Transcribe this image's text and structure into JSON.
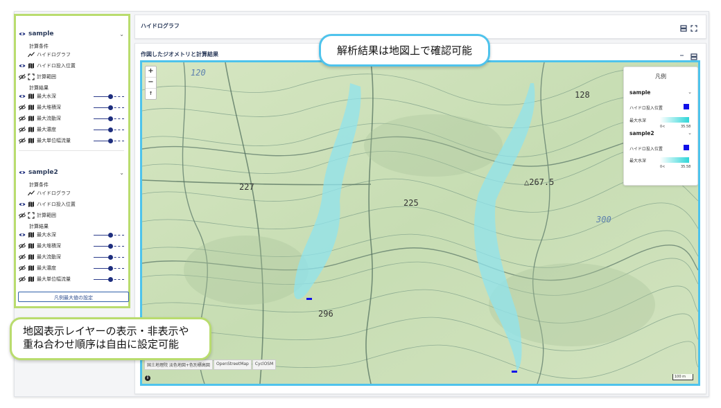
{
  "colors": {
    "accent_blue": "#4ec3ec",
    "accent_green": "#b9dc6e",
    "brand_navy": "#2a3a5a",
    "map_land": "#cfe1bb",
    "water_overlay": "#8fe3ee",
    "hydro_point": "#1010e8"
  },
  "sidebar": {
    "groups": [
      {
        "name": "sample",
        "conditions_label": "計算条件",
        "conditions": [
          {
            "label": "ハイドログラフ",
            "icon": "line-chart-icon"
          },
          {
            "label": "ハイドロ投入位置",
            "icon": "map-icon",
            "visible": true
          },
          {
            "label": "計算範囲",
            "icon": "extent-icon",
            "visible": false
          }
        ],
        "results_label": "計算結果",
        "results": [
          {
            "label": "最大水深",
            "visible": true,
            "opacity": 0.55
          },
          {
            "label": "最大堆積深",
            "visible": false,
            "opacity": 0.55
          },
          {
            "label": "最大流動深",
            "visible": false,
            "opacity": 0.55
          },
          {
            "label": "最大濃度",
            "visible": false,
            "opacity": 0.55
          },
          {
            "label": "最大単位幅流量",
            "visible": false,
            "opacity": 0.55
          }
        ]
      },
      {
        "name": "sample2",
        "conditions_label": "計算条件",
        "conditions": [
          {
            "label": "ハイドログラフ",
            "icon": "line-chart-icon"
          },
          {
            "label": "ハイドロ投入位置",
            "icon": "map-icon",
            "visible": true
          },
          {
            "label": "計算範囲",
            "icon": "extent-icon",
            "visible": false
          }
        ],
        "results_label": "計算結果",
        "results": [
          {
            "label": "最大水深",
            "visible": true,
            "opacity": 0.55
          },
          {
            "label": "最大堆積深",
            "visible": false,
            "opacity": 0.55
          },
          {
            "label": "最大流動深",
            "visible": false,
            "opacity": 0.55
          },
          {
            "label": "最大濃度",
            "visible": false,
            "opacity": 0.55
          },
          {
            "label": "最大単位幅流量",
            "visible": false,
            "opacity": 0.55
          }
        ]
      }
    ],
    "legend_button": "凡例最大値の設定"
  },
  "hydro_panel": {
    "title": "ハイドログラフ"
  },
  "map_panel": {
    "title": "作図したジオメトリと計算結果"
  },
  "map": {
    "zoom_in": "+",
    "zoom_out": "−",
    "north": "↑",
    "contour_labels": [
      "120",
      "128",
      "227",
      "225",
      "△267.5",
      "300",
      "296"
    ],
    "attribution": [
      "国土地理院 淡色地図+色別標高図",
      "OpenStreetMap",
      "CyclOSM"
    ],
    "info": "i",
    "scale": "100 m",
    "legend": {
      "title": "凡例",
      "groups": [
        {
          "name": "sample",
          "items": [
            {
              "label": "ハイドロ投入位置"
            },
            {
              "label": "最大水深",
              "min": "0<",
              "max": "35.58"
            }
          ]
        },
        {
          "name": "sample2",
          "items": [
            {
              "label": "ハイドロ投入位置"
            },
            {
              "label": "最大水深",
              "min": "0<",
              "max": "35.58"
            }
          ]
        }
      ]
    }
  },
  "callouts": {
    "top": "解析結果は地図上で確認可能",
    "left_line1": "地図表示レイヤーの表示・非表示や",
    "left_line2": "重ね合わせ順序は自由に設定可能"
  }
}
